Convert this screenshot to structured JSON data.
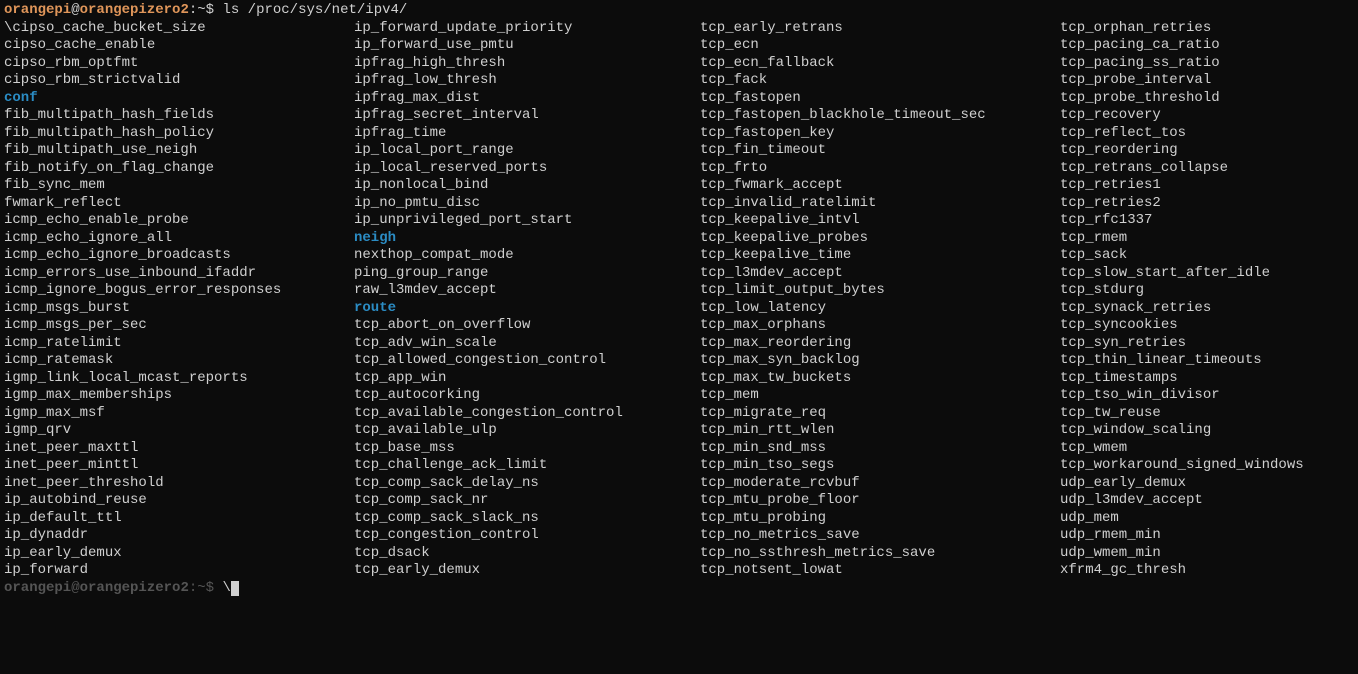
{
  "prompt": {
    "user": "orangepi",
    "at": "@",
    "host": "orangepizero2",
    "path_sep": ":",
    "path": "~",
    "symbol": "$"
  },
  "command": "ls /proc/sys/net/ipv4/",
  "columns": [
    [
      {
        "name": "\\cipso_cache_bucket_size",
        "dir": false
      },
      {
        "name": "cipso_cache_enable",
        "dir": false
      },
      {
        "name": "cipso_rbm_optfmt",
        "dir": false
      },
      {
        "name": "cipso_rbm_strictvalid",
        "dir": false
      },
      {
        "name": "conf",
        "dir": true
      },
      {
        "name": "fib_multipath_hash_fields",
        "dir": false
      },
      {
        "name": "fib_multipath_hash_policy",
        "dir": false
      },
      {
        "name": "fib_multipath_use_neigh",
        "dir": false
      },
      {
        "name": "fib_notify_on_flag_change",
        "dir": false
      },
      {
        "name": "fib_sync_mem",
        "dir": false
      },
      {
        "name": "fwmark_reflect",
        "dir": false
      },
      {
        "name": "icmp_echo_enable_probe",
        "dir": false
      },
      {
        "name": "icmp_echo_ignore_all",
        "dir": false
      },
      {
        "name": "icmp_echo_ignore_broadcasts",
        "dir": false
      },
      {
        "name": "icmp_errors_use_inbound_ifaddr",
        "dir": false
      },
      {
        "name": "icmp_ignore_bogus_error_responses",
        "dir": false
      },
      {
        "name": "icmp_msgs_burst",
        "dir": false
      },
      {
        "name": "icmp_msgs_per_sec",
        "dir": false
      },
      {
        "name": "icmp_ratelimit",
        "dir": false
      },
      {
        "name": "icmp_ratemask",
        "dir": false
      },
      {
        "name": "igmp_link_local_mcast_reports",
        "dir": false
      },
      {
        "name": "igmp_max_memberships",
        "dir": false
      },
      {
        "name": "igmp_max_msf",
        "dir": false
      },
      {
        "name": "igmp_qrv",
        "dir": false
      },
      {
        "name": "inet_peer_maxttl",
        "dir": false
      },
      {
        "name": "inet_peer_minttl",
        "dir": false
      },
      {
        "name": "inet_peer_threshold",
        "dir": false
      },
      {
        "name": "ip_autobind_reuse",
        "dir": false
      },
      {
        "name": "ip_default_ttl",
        "dir": false
      },
      {
        "name": "ip_dynaddr",
        "dir": false
      },
      {
        "name": "ip_early_demux",
        "dir": false
      },
      {
        "name": "ip_forward",
        "dir": false
      }
    ],
    [
      {
        "name": " ip_forward_update_priority",
        "dir": false
      },
      {
        "name": "ip_forward_use_pmtu",
        "dir": false
      },
      {
        "name": "ipfrag_high_thresh",
        "dir": false
      },
      {
        "name": "ipfrag_low_thresh",
        "dir": false
      },
      {
        "name": "ipfrag_max_dist",
        "dir": false
      },
      {
        "name": "ipfrag_secret_interval",
        "dir": false
      },
      {
        "name": "ipfrag_time",
        "dir": false
      },
      {
        "name": "ip_local_port_range",
        "dir": false
      },
      {
        "name": "ip_local_reserved_ports",
        "dir": false
      },
      {
        "name": "ip_nonlocal_bind",
        "dir": false
      },
      {
        "name": "ip_no_pmtu_disc",
        "dir": false
      },
      {
        "name": "ip_unprivileged_port_start",
        "dir": false
      },
      {
        "name": "neigh",
        "dir": true
      },
      {
        "name": "nexthop_compat_mode",
        "dir": false
      },
      {
        "name": "ping_group_range",
        "dir": false
      },
      {
        "name": "raw_l3mdev_accept",
        "dir": false
      },
      {
        "name": "route",
        "dir": true
      },
      {
        "name": "tcp_abort_on_overflow",
        "dir": false
      },
      {
        "name": "tcp_adv_win_scale",
        "dir": false
      },
      {
        "name": "tcp_allowed_congestion_control",
        "dir": false
      },
      {
        "name": "tcp_app_win",
        "dir": false
      },
      {
        "name": "tcp_autocorking",
        "dir": false
      },
      {
        "name": "tcp_available_congestion_control",
        "dir": false
      },
      {
        "name": "tcp_available_ulp",
        "dir": false
      },
      {
        "name": "tcp_base_mss",
        "dir": false
      },
      {
        "name": "tcp_challenge_ack_limit",
        "dir": false
      },
      {
        "name": "tcp_comp_sack_delay_ns",
        "dir": false
      },
      {
        "name": "tcp_comp_sack_nr",
        "dir": false
      },
      {
        "name": "tcp_comp_sack_slack_ns",
        "dir": false
      },
      {
        "name": "tcp_congestion_control",
        "dir": false
      },
      {
        "name": "tcp_dsack",
        "dir": false
      },
      {
        "name": "tcp_early_demux",
        "dir": false
      }
    ],
    [
      {
        "name": " tcp_early_retrans",
        "dir": false
      },
      {
        "name": "tcp_ecn",
        "dir": false
      },
      {
        "name": "tcp_ecn_fallback",
        "dir": false
      },
      {
        "name": "tcp_fack",
        "dir": false
      },
      {
        "name": "tcp_fastopen",
        "dir": false
      },
      {
        "name": "tcp_fastopen_blackhole_timeout_sec",
        "dir": false
      },
      {
        "name": "tcp_fastopen_key",
        "dir": false
      },
      {
        "name": "tcp_fin_timeout",
        "dir": false
      },
      {
        "name": "tcp_frto",
        "dir": false
      },
      {
        "name": "tcp_fwmark_accept",
        "dir": false
      },
      {
        "name": "tcp_invalid_ratelimit",
        "dir": false
      },
      {
        "name": "tcp_keepalive_intvl",
        "dir": false
      },
      {
        "name": "tcp_keepalive_probes",
        "dir": false
      },
      {
        "name": "tcp_keepalive_time",
        "dir": false
      },
      {
        "name": "tcp_l3mdev_accept",
        "dir": false
      },
      {
        "name": "tcp_limit_output_bytes",
        "dir": false
      },
      {
        "name": "tcp_low_latency",
        "dir": false
      },
      {
        "name": "tcp_max_orphans",
        "dir": false
      },
      {
        "name": "tcp_max_reordering",
        "dir": false
      },
      {
        "name": "tcp_max_syn_backlog",
        "dir": false
      },
      {
        "name": "tcp_max_tw_buckets",
        "dir": false
      },
      {
        "name": "tcp_mem",
        "dir": false
      },
      {
        "name": "tcp_migrate_req",
        "dir": false
      },
      {
        "name": "tcp_min_rtt_wlen",
        "dir": false
      },
      {
        "name": "tcp_min_snd_mss",
        "dir": false
      },
      {
        "name": "tcp_min_tso_segs",
        "dir": false
      },
      {
        "name": "tcp_moderate_rcvbuf",
        "dir": false
      },
      {
        "name": "tcp_mtu_probe_floor",
        "dir": false
      },
      {
        "name": "tcp_mtu_probing",
        "dir": false
      },
      {
        "name": "tcp_no_metrics_save",
        "dir": false
      },
      {
        "name": "tcp_no_ssthresh_metrics_save",
        "dir": false
      },
      {
        "name": "tcp_notsent_lowat",
        "dir": false
      }
    ],
    [
      {
        "name": " tcp_orphan_retries",
        "dir": false
      },
      {
        "name": "tcp_pacing_ca_ratio",
        "dir": false
      },
      {
        "name": "tcp_pacing_ss_ratio",
        "dir": false
      },
      {
        "name": "tcp_probe_interval",
        "dir": false
      },
      {
        "name": "tcp_probe_threshold",
        "dir": false
      },
      {
        "name": "tcp_recovery",
        "dir": false
      },
      {
        "name": "tcp_reflect_tos",
        "dir": false
      },
      {
        "name": "tcp_reordering",
        "dir": false
      },
      {
        "name": "tcp_retrans_collapse",
        "dir": false
      },
      {
        "name": "tcp_retries1",
        "dir": false
      },
      {
        "name": "tcp_retries2",
        "dir": false
      },
      {
        "name": "tcp_rfc1337",
        "dir": false
      },
      {
        "name": "tcp_rmem",
        "dir": false
      },
      {
        "name": "tcp_sack",
        "dir": false
      },
      {
        "name": "tcp_slow_start_after_idle",
        "dir": false
      },
      {
        "name": "tcp_stdurg",
        "dir": false
      },
      {
        "name": "tcp_synack_retries",
        "dir": false
      },
      {
        "name": "tcp_syncookies",
        "dir": false
      },
      {
        "name": "tcp_syn_retries",
        "dir": false
      },
      {
        "name": "tcp_thin_linear_timeouts",
        "dir": false
      },
      {
        "name": "tcp_timestamps",
        "dir": false
      },
      {
        "name": "tcp_tso_win_divisor",
        "dir": false
      },
      {
        "name": "tcp_tw_reuse",
        "dir": false
      },
      {
        "name": "tcp_window_scaling",
        "dir": false
      },
      {
        "name": "tcp_wmem",
        "dir": false
      },
      {
        "name": "tcp_workaround_signed_windows",
        "dir": false
      },
      {
        "name": "udp_early_demux",
        "dir": false
      },
      {
        "name": "udp_l3mdev_accept",
        "dir": false
      },
      {
        "name": "udp_mem",
        "dir": false
      },
      {
        "name": "udp_rmem_min",
        "dir": false
      },
      {
        "name": "udp_wmem_min",
        "dir": false
      },
      {
        "name": "xfrm4_gc_thresh",
        "dir": false
      }
    ]
  ],
  "next_prompt_partial": "\\"
}
